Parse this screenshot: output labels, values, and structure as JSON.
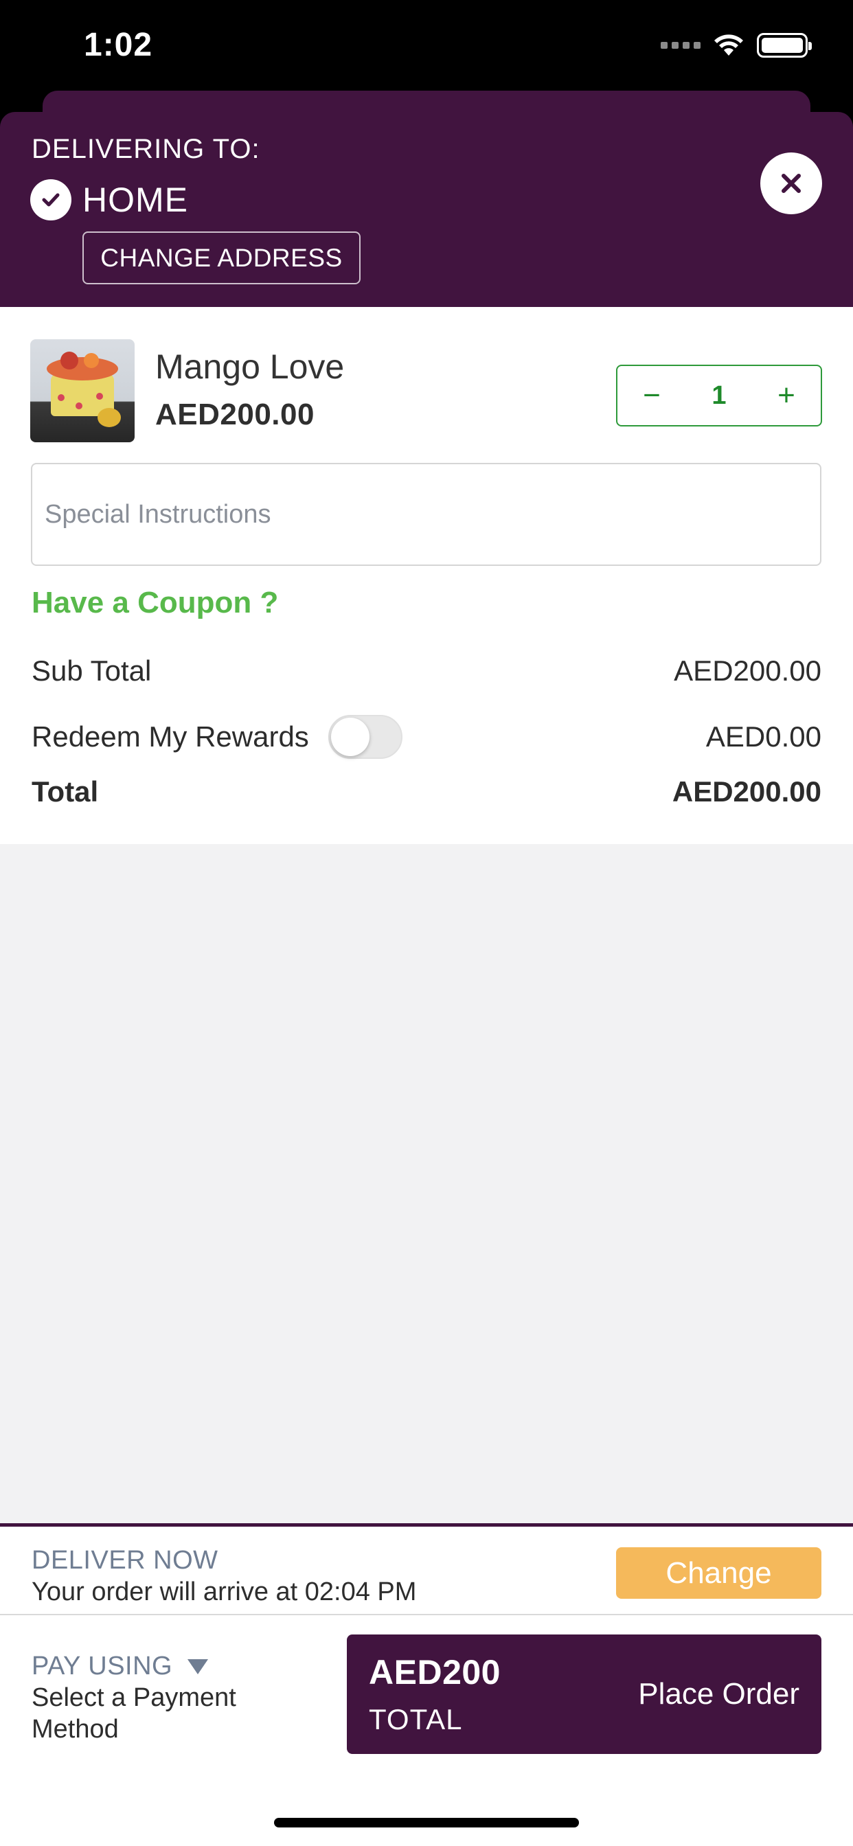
{
  "status_bar": {
    "time": "1:02"
  },
  "header": {
    "delivering_label": "DELIVERING TO:",
    "address_name": "HOME",
    "change_address_label": "CHANGE ADDRESS"
  },
  "cart": {
    "item": {
      "name": "Mango Love",
      "price": "AED200.00",
      "quantity": "1",
      "minus": "−",
      "plus": "+"
    },
    "instructions_placeholder": "Special Instructions",
    "coupon_label": "Have a Coupon ?",
    "subtotal": {
      "label": "Sub Total",
      "value": "AED200.00"
    },
    "rewards": {
      "label": "Redeem My Rewards",
      "value": "AED0.00",
      "enabled": false
    },
    "total": {
      "label": "Total",
      "value": "AED200.00"
    }
  },
  "delivery": {
    "mode_label": "DELIVER NOW",
    "arrival_text": "Your order will arrive at 02:04 PM",
    "change_label": "Change"
  },
  "payment": {
    "label": "PAY USING",
    "method_text": "Select a Payment Method"
  },
  "place_order": {
    "amount": "AED200",
    "total_label": "TOTAL",
    "button_label": "Place Order"
  },
  "colors": {
    "brand_purple": "#41143f",
    "accent_green": "#58b94b",
    "qty_green": "#1f8a2b",
    "change_orange": "#f5b95b"
  }
}
